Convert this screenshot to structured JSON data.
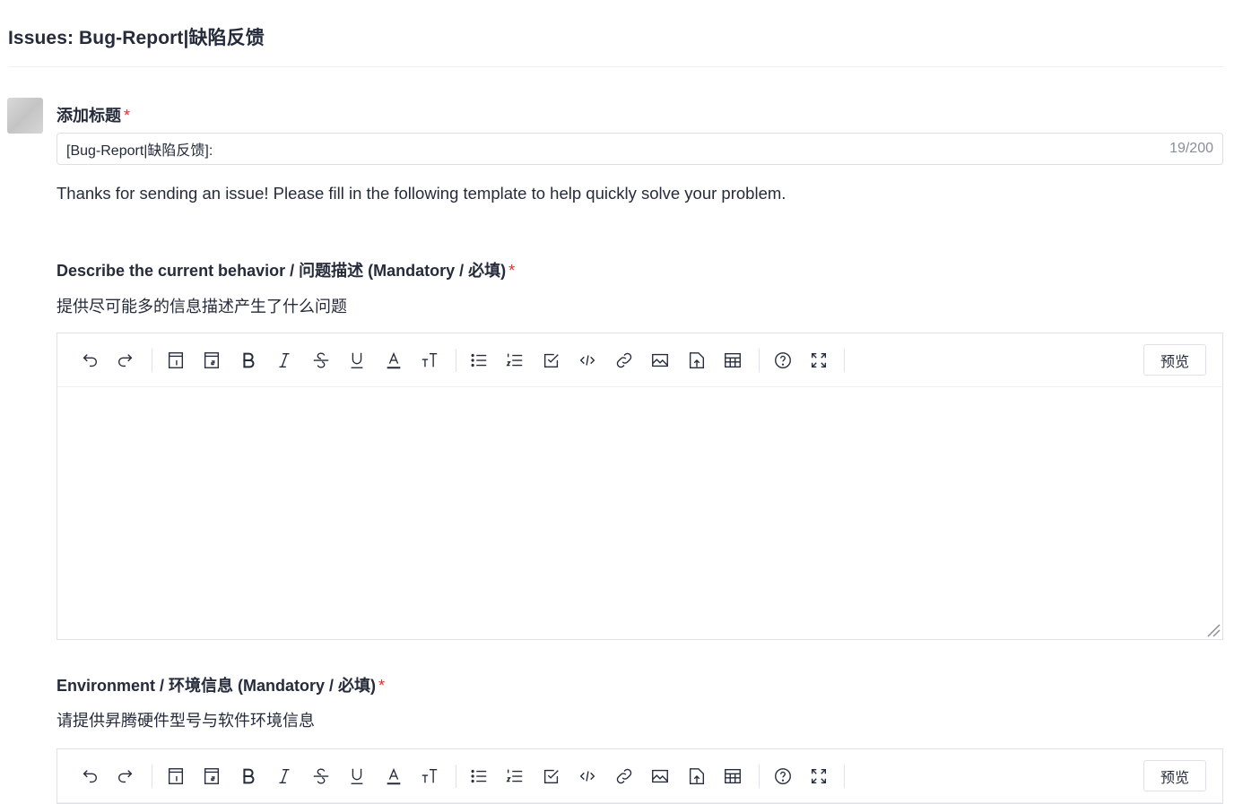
{
  "header": {
    "title": "Issues: Bug-Report|缺陷反馈"
  },
  "title_field": {
    "label": "添加标题",
    "required_mark": "*",
    "value": "[Bug-Report|缺陷反馈]:",
    "char_count": "19/200"
  },
  "intro": "Thanks for sending an issue! Please fill in the following template to help quickly solve your problem.",
  "sections": [
    {
      "label": "Describe the current behavior / 问题描述 (Mandatory / 必填)",
      "required_mark": "*",
      "hint": "提供尽可能多的信息描述产生了什么问题",
      "preview_label": "预览"
    },
    {
      "label": "Environment / 环境信息 (Mandatory / 必填)",
      "required_mark": "*",
      "hint": "请提供昇腾硬件型号与软件环境信息",
      "preview_label": "预览"
    }
  ],
  "toolbar_icons": [
    "undo-icon",
    "redo-icon",
    "heading1-icon",
    "heading2-icon",
    "bold-icon",
    "italic-icon",
    "strikethrough-icon",
    "underline-icon",
    "font-color-icon",
    "font-size-icon",
    "bullet-list-icon",
    "ordered-list-icon",
    "checklist-icon",
    "code-icon",
    "link-icon",
    "image-icon",
    "upload-icon",
    "table-icon",
    "help-icon",
    "fullscreen-icon"
  ]
}
